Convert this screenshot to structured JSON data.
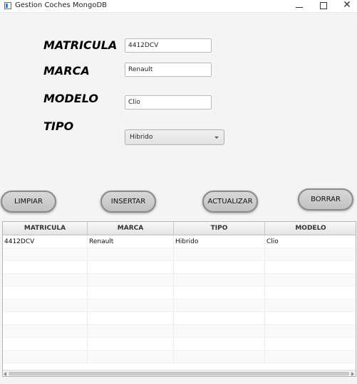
{
  "window": {
    "title": "Gestion Coches MongoDB",
    "minimize_glyph": "—",
    "close_glyph": "✕"
  },
  "form": {
    "matricula_label": "MATRICULA",
    "matricula_value": "4412DCV",
    "marca_label": "MARCA",
    "marca_value": "Renault",
    "modelo_label": "MODELO",
    "modelo_value": "Clio",
    "tipo_label": "TIPO",
    "tipo_value": "Hibrido"
  },
  "buttons": {
    "limpiar": "LIMPIAR",
    "insertar": "INSERTAR",
    "actualizar": "ACTUALIZAR",
    "borrar": "BORRAR"
  },
  "table": {
    "columns": [
      "MATRICULA",
      "MARCA",
      "TIPO",
      "MODELO"
    ],
    "rows": [
      [
        "4412DCV",
        "Renault",
        "Hibrido",
        "Clio"
      ]
    ]
  },
  "icons": {
    "app": "app-window-icon",
    "minimize": "minimize-icon",
    "maximize": "maximize-icon",
    "close": "close-icon",
    "dropdown": "chevron-down-icon"
  }
}
